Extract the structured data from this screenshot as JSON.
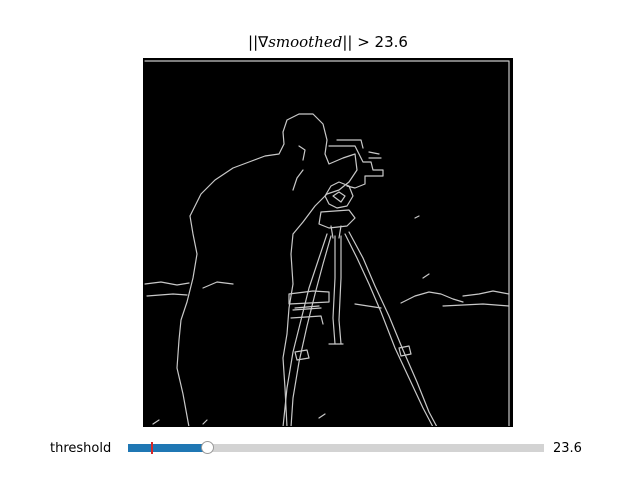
{
  "figure": {
    "title_prefix": "||∇",
    "title_var": "smoothed",
    "title_suffix": "|| > 23.6"
  },
  "slider": {
    "label": "threshold",
    "value_text": "23.6",
    "value": 23.6,
    "fraction": 0.19,
    "initial_fraction": 0.055,
    "fill_color": "#1f77b4",
    "track_color": "#d3d3d3",
    "marker_color": "#d62728"
  },
  "image": {
    "edge_color": "#c8c8c8",
    "background_color": "#000000"
  }
}
